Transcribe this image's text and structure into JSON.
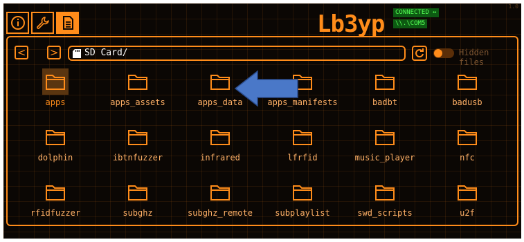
{
  "app": {
    "logo": "Lb3yp",
    "status_connected": "CONNECTED ↔",
    "status_port": "\\\\.\\COM5",
    "version": "1.0"
  },
  "tabs": [
    {
      "name": "info",
      "active": false
    },
    {
      "name": "tools",
      "active": false
    },
    {
      "name": "files",
      "active": true
    }
  ],
  "toolbar": {
    "back": "<",
    "forward": ">",
    "path": "SD Card/",
    "hidden_files_label": "Hidden files",
    "hidden_files_enabled": true
  },
  "folders": [
    {
      "label": "apps",
      "selected": true
    },
    {
      "label": "apps_assets",
      "selected": false
    },
    {
      "label": "apps_data",
      "selected": false
    },
    {
      "label": "apps_manifests",
      "selected": false
    },
    {
      "label": "badbt",
      "selected": false
    },
    {
      "label": "badusb",
      "selected": false
    },
    {
      "label": "dolphin",
      "selected": false
    },
    {
      "label": "ibtnfuzzer",
      "selected": false
    },
    {
      "label": "infrared",
      "selected": false
    },
    {
      "label": "lfrfid",
      "selected": false
    },
    {
      "label": "music_player",
      "selected": false
    },
    {
      "label": "nfc",
      "selected": false
    },
    {
      "label": "rfidfuzzer",
      "selected": false
    },
    {
      "label": "subghz",
      "selected": false
    },
    {
      "label": "subghz_remote",
      "selected": false
    },
    {
      "label": "subplaylist",
      "selected": false
    },
    {
      "label": "swd_scripts",
      "selected": false
    },
    {
      "label": "u2f",
      "selected": false
    }
  ],
  "colors": {
    "accent": "#ff8c1a",
    "background": "#0b0704",
    "annotation_arrow": "#4a78c8"
  }
}
